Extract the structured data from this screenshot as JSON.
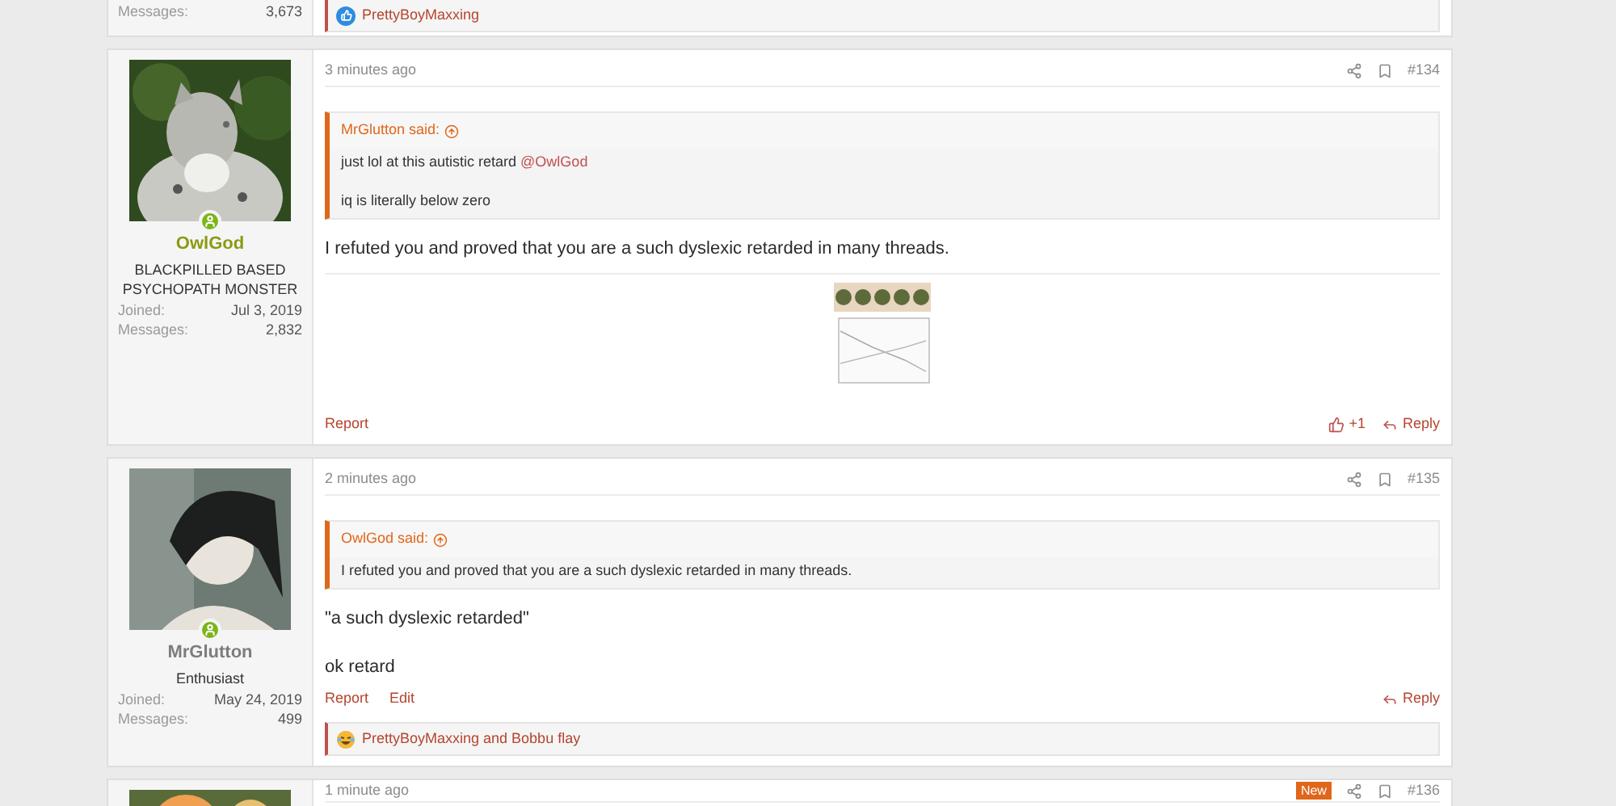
{
  "top_post_fragment": {
    "messages_label": "Messages:",
    "messages": "3,673",
    "reactions": {
      "kind": "like",
      "text": "PrettyBoyMaxxing"
    }
  },
  "posts": [
    {
      "author": "OwlGod",
      "author_highlight": true,
      "online": true,
      "title": "BLACKPILLED BASED PSYCHOPATH MONSTER",
      "joined_label": "Joined:",
      "joined": "Jul 3, 2019",
      "messages_label": "Messages:",
      "messages": "2,832",
      "time": "3 minutes ago",
      "new": false,
      "number": "#134",
      "quote": {
        "said": "MrGlutton said:",
        "lines": [
          [
            {
              "text": "just lol at this autistic retard "
            },
            {
              "text": "@OwlGod",
              "kind": "mention"
            }
          ],
          [
            {
              "text": "iq is literally below zero"
            }
          ]
        ]
      },
      "body": [
        "I refuted you and proved that you are a such dyslexic retarded in many threads."
      ],
      "image": true,
      "actions": [
        "Report"
      ],
      "like": "+1",
      "reply": "Reply"
    },
    {
      "author": "MrGlutton",
      "author_highlight": false,
      "online": true,
      "title": "Enthusiast",
      "joined_label": "Joined:",
      "joined": "May 24, 2019",
      "messages_label": "Messages:",
      "messages": "499",
      "time": "2 minutes ago",
      "new": false,
      "number": "#135",
      "quote": {
        "said": "OwlGod said:",
        "lines": [
          [
            {
              "text": "I refuted you and proved that you are a such dyslexic retarded in many threads."
            }
          ]
        ]
      },
      "body": [
        "\"a such dyslexic retarded\"",
        "ok retard"
      ],
      "image": false,
      "actions": [
        "Report",
        "Edit"
      ],
      "reply": "Reply",
      "reactions": {
        "kind": "haha",
        "text": "PrettyBoyMaxxing and Bobbu flay"
      }
    },
    {
      "time": "1 minute ago",
      "new": true,
      "new_label": "New",
      "number": "#136"
    }
  ]
}
